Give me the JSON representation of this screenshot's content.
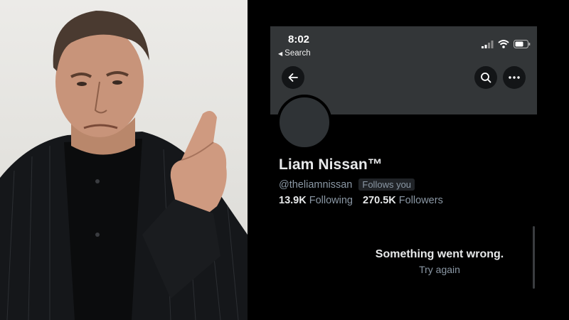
{
  "status_bar": {
    "time": "8:02",
    "back_app": "Search"
  },
  "profile": {
    "display_name": "Liam Nissan™",
    "handle": "@theliamnissan",
    "follows_you_badge": "Follows you",
    "following_count": "13.9K",
    "following_label": "Following",
    "followers_count": "270.5K",
    "followers_label": "Followers"
  },
  "error_state": {
    "message": "Something went wrong.",
    "retry_label": "Try again"
  },
  "icons": {
    "back": "back-arrow-icon",
    "search": "search-icon",
    "more": "more-options-icon",
    "signal": "cellular-signal-icon",
    "wifi": "wifi-icon",
    "battery": "battery-icon"
  },
  "colors": {
    "background": "#000000",
    "banner": "#333638",
    "primary_text": "#e7e9ea",
    "secondary_text": "#8b98a5"
  }
}
